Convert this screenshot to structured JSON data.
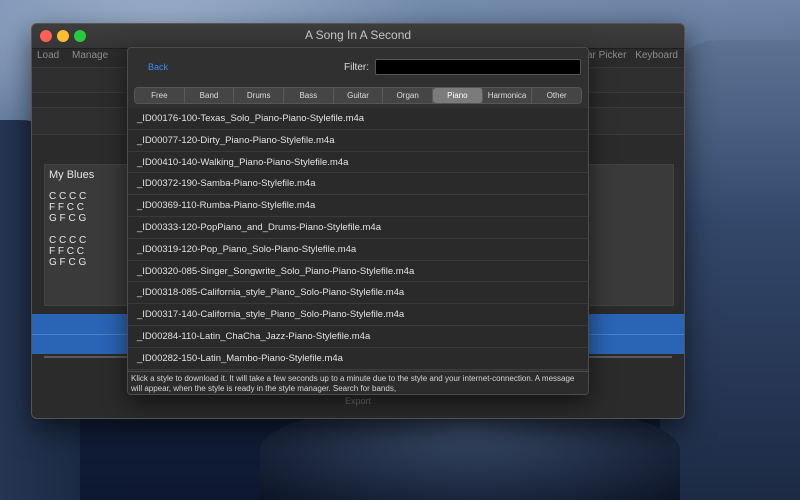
{
  "window": {
    "title": "A Song In A Second",
    "menu_left": [
      "Load",
      "Manage"
    ],
    "menu_right": [
      "ar Picker",
      "Keyboard"
    ],
    "export_label": "Export"
  },
  "song": {
    "title": "My Blues",
    "chords": "C C C C\nF F C C\nG F C G\n\nC C C C\nF F C C\nG F C G"
  },
  "picker": {
    "back_label": "Back",
    "filter_label": "Filter:",
    "filter_value": "",
    "categories": [
      "Free",
      "Band",
      "Drums",
      "Bass",
      "Guitar",
      "Organ",
      "Piano",
      "Harmonica",
      "Other"
    ],
    "selected_category": "Piano",
    "styles": [
      "_ID00176-100-Texas_Solo_Piano-Piano-Stylefile.m4a",
      "_ID00077-120-Dirty_Piano-Piano-Stylefile.m4a",
      "_ID00410-140-Walking_Piano-Piano-Stylefile.m4a",
      "_ID00372-190-Samba-Piano-Stylefile.m4a",
      "_ID00369-110-Rumba-Piano-Stylefile.m4a",
      "_ID00333-120-PopPiano_and_Drums-Piano-Stylefile.m4a",
      "_ID00319-120-Pop_Piano_Solo-Piano-Stylefile.m4a",
      "_ID00320-085-Singer_Songwrite_Solo_Piano-Piano-Stylefile.m4a",
      "_ID00318-085-California_style_Piano_Solo-Piano-Stylefile.m4a",
      "_ID00317-140-California_style_Piano_Solo-Piano-Stylefile.m4a",
      "_ID00284-110-Latin_ChaCha_Jazz-Piano-Stylefile.m4a",
      "_ID00282-150-Latin_Mambo-Piano-Stylefile.m4a"
    ],
    "info_text": "Klick a style to download it.  It will take a few seconds up to a minute due to the style and your internet-connection. A message will appear, when the style is ready in the style manager. Search for bands,"
  },
  "colors": {
    "accent_blue": "#2a64b5",
    "link_blue": "#3b8cf2",
    "close": "#ff5f57",
    "minimize": "#febc2e",
    "maximize": "#28c840"
  }
}
